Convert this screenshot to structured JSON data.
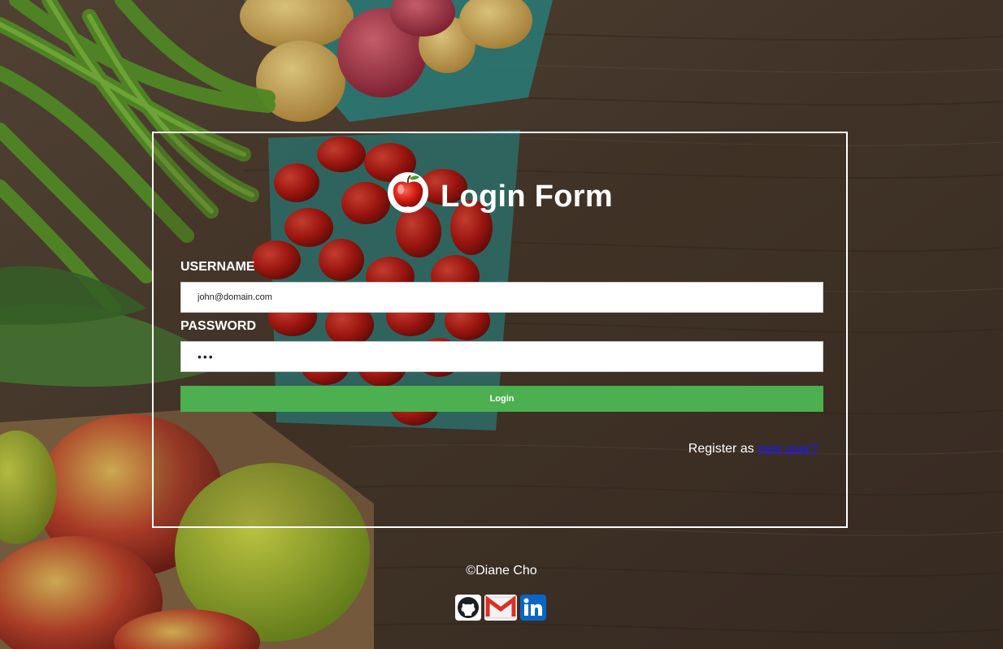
{
  "login_form": {
    "title": "Login Form",
    "logo_icon": "apple-icon",
    "username_label": "USERNAME",
    "username_value": "john@domain.com",
    "password_label": "PASSWORD",
    "password_value": "•••",
    "login_button": "Login",
    "register_text": "Register as ",
    "register_link": "new user?"
  },
  "footer": {
    "copyright": "©Diane Cho",
    "social_icons": [
      "github-icon",
      "gmail-icon",
      "linkedin-icon"
    ]
  },
  "colors": {
    "button": "#4caf50",
    "link": "#1a1aff",
    "border": "#ffffff"
  }
}
